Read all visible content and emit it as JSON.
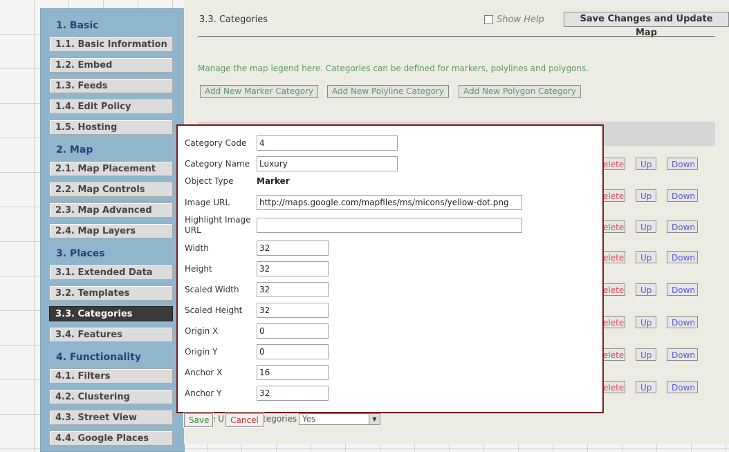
{
  "sidebar": {
    "sections": [
      {
        "title": "1. Basic",
        "items": [
          "1.1. Basic Information",
          "1.2. Embed",
          "1.3. Feeds",
          "1.4. Edit Policy",
          "1.5. Hosting"
        ]
      },
      {
        "title": "2. Map",
        "items": [
          "2.1. Map Placement",
          "2.2. Map Controls",
          "2.3. Map Advanced",
          "2.4. Map Layers"
        ]
      },
      {
        "title": "3. Places",
        "items": [
          "3.1. Extended Data",
          "3.2. Templates",
          "3.3. Categories",
          "3.4. Features"
        ]
      },
      {
        "title": "4. Functionality",
        "items": [
          "4.1. Filters",
          "4.2. Clustering",
          "4.3. Street View",
          "4.4. Google Places"
        ]
      }
    ],
    "active_item": "3.3. Categories"
  },
  "header": {
    "title": "3.3. Categories",
    "show_help_label": "Show Help",
    "save_update_label": "Save Changes and Update Map"
  },
  "content": {
    "manage_text": "Manage the map legend here. Categories can be defined for markers, polylines and polygons.",
    "add_marker_label": "Add New Marker Category",
    "add_polyline_label": "Add New Polyline Category",
    "add_polygon_label": "Add New Polygon Category",
    "row_delete_label": "elete",
    "row_up_label": "Up",
    "row_down_label": "Down",
    "below_text": "e U",
    "below_text_2": "ategories",
    "select_value": "Yes"
  },
  "dialog": {
    "fields": {
      "category_code": {
        "label": "Category Code",
        "value": "4"
      },
      "category_name": {
        "label": "Category Name",
        "value": "Luxury"
      },
      "object_type": {
        "label": "Object Type",
        "value": "Marker"
      },
      "image_url": {
        "label": "Image URL",
        "value": "http://maps.google.com/mapfiles/ms/micons/yellow-dot.png"
      },
      "highlight_image_url": {
        "label": "Highlight Image URL",
        "value": ""
      },
      "width": {
        "label": "Width",
        "value": "32"
      },
      "height": {
        "label": "Height",
        "value": "32"
      },
      "scaled_width": {
        "label": "Scaled Width",
        "value": "32"
      },
      "scaled_height": {
        "label": "Scaled Height",
        "value": "32"
      },
      "origin_x": {
        "label": "Origin X",
        "value": "0"
      },
      "origin_y": {
        "label": "Origin Y",
        "value": "0"
      },
      "anchor_x": {
        "label": "Anchor X",
        "value": "16"
      },
      "anchor_y": {
        "label": "Anchor Y",
        "value": "32"
      }
    },
    "save_label": "Save",
    "cancel_label": "Cancel"
  },
  "colors": {
    "sidebar_bg": "#8fb6cc",
    "section_title": "#2c3f77",
    "active_item_bg": "#3a3a3a",
    "dialog_border": "#7a1a1a",
    "green_text": "#5a9a5a",
    "delete_red": "#e05050",
    "link_blue": "#5a5ad0"
  }
}
